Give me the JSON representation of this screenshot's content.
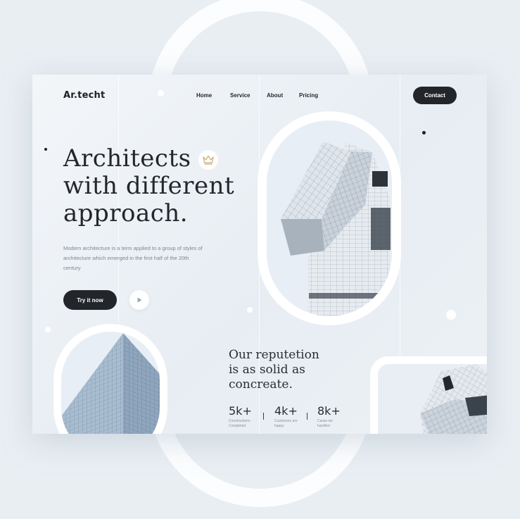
{
  "header": {
    "logo": "Ar.techt",
    "nav": [
      "Home",
      "Service",
      "About",
      "Pricing"
    ],
    "contact_label": "Contact"
  },
  "hero": {
    "headline": [
      "Architects",
      "with different",
      "approach."
    ],
    "description": "Modern architecture is a term applied to a group of styles of architecture which emerged in the first half of the 20th century",
    "try_label": "Try it now"
  },
  "reputation": {
    "headline": [
      "Our reputetion",
      "is as solid as",
      "concreate."
    ]
  },
  "stats": [
    {
      "value": "5k+",
      "label": "Constructions Completed"
    },
    {
      "value": "4k+",
      "label": "Customers are happy"
    },
    {
      "value": "8k+",
      "label": "Cases we handled"
    }
  ],
  "colors": {
    "accent_dark": "#22252a",
    "background": "#e9eef3"
  },
  "icons": [
    "crown-icon",
    "play-icon"
  ]
}
